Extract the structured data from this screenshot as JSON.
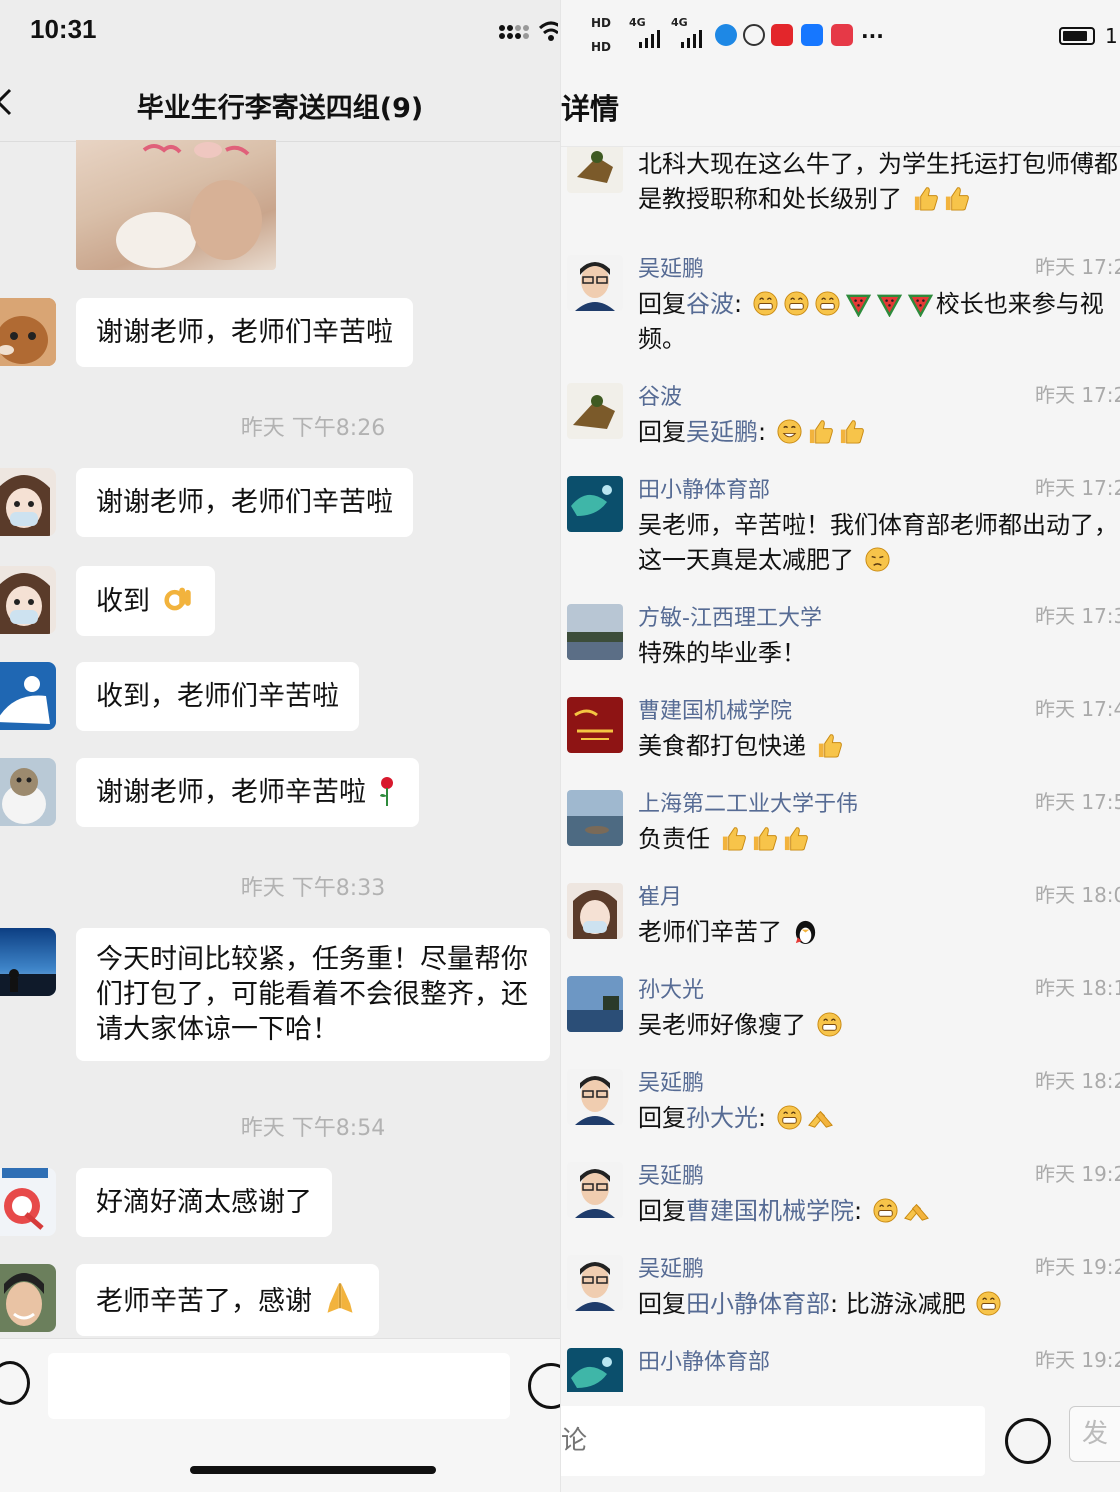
{
  "left": {
    "status_time": "10:31",
    "chat_title": "毕业生行李寄送四组(9)",
    "messages": [
      {
        "type": "image",
        "name": "cat-sticker"
      },
      {
        "text": "谢谢老师，老师们辛苦啦"
      },
      {
        "ts": "昨天 下午8:26"
      },
      {
        "text": "谢谢老师，老师们辛苦啦"
      },
      {
        "text": "收到",
        "emoji": "ok-hand-icon"
      },
      {
        "text": "收到，老师们辛苦啦"
      },
      {
        "text": "谢谢老师，老师辛苦啦",
        "emoji": "rose-icon"
      },
      {
        "ts": "昨天 下午8:33"
      },
      {
        "text": "今天时间比较紧，任务重！尽量帮你们打包了，可能看着不会很整齐，还请大家体谅一下哈！"
      },
      {
        "ts": "昨天 下午8:54"
      },
      {
        "text": "好滴好滴太感谢了"
      },
      {
        "text": "老师辛苦了，感谢",
        "emoji": "pray-icon"
      }
    ]
  },
  "right": {
    "page_title": "详情",
    "status": {
      "hd1": "HD",
      "hd2": "HD",
      "net1": "4G",
      "net2": "4G",
      "dots": "···",
      "clock": "1"
    },
    "comments": [
      {
        "name": "",
        "time": "",
        "text": "北科大现在这么牛了，为学生托运打包师傅都是教授职称和处长级别了"
      },
      {
        "name": "吴延鹏",
        "time": "昨天 17:2",
        "prefix": "回复",
        "mention": "谷波",
        "colon": ":",
        "tail": "校长也来参与视频。"
      },
      {
        "name": "谷波",
        "time": "昨天 17:2",
        "prefix": "回复",
        "mention": "吴延鹏",
        "colon": ":",
        "tail": ""
      },
      {
        "name": "田小静体育部",
        "time": "昨天 17:2",
        "text": "吴老师，辛苦啦！我们体育部老师都出动了，这一天真是太减肥了"
      },
      {
        "name": "方敏-江西理工大学",
        "time": "昨天 17:3",
        "text": "特殊的毕业季！"
      },
      {
        "name": "曹建国机械学院",
        "time": "昨天 17:4",
        "text": "美食都打包快递"
      },
      {
        "name": "上海第二工业大学于伟",
        "time": "昨天 17:5",
        "text": "负责任"
      },
      {
        "name": "崔月",
        "time": "昨天 18:0",
        "text": "老师们辛苦了"
      },
      {
        "name": "孙大光",
        "time": "昨天 18:1",
        "text": "吴老师好像瘦了"
      },
      {
        "name": "吴延鹏",
        "time": "昨天 18:2",
        "prefix": "回复",
        "mention": "孙大光",
        "colon": ":",
        "tail": ""
      },
      {
        "name": "吴延鹏",
        "time": "昨天 19:2",
        "prefix": "回复",
        "mention": "曹建国机械学院",
        "colon": ":",
        "tail": ""
      },
      {
        "name": "吴延鹏",
        "time": "昨天 19:2",
        "prefix": "回复",
        "mention": "田小静体育部",
        "colon": ":",
        "tail": "比游泳减肥"
      },
      {
        "name": "田小静体育部",
        "time": "昨天 19:2",
        "text": ""
      }
    ],
    "comment_placeholder": "论",
    "send_label": "发"
  },
  "colors": {
    "link": "#566b94",
    "bubble": "#ffffff",
    "chat_bg": "#ededed"
  }
}
